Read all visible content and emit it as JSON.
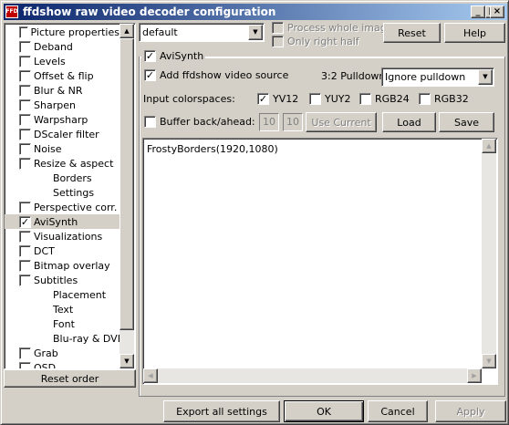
{
  "window": {
    "title": "ffdshow raw video decoder configuration",
    "icon_text": "FFD",
    "minimize": "_",
    "maximize": "□",
    "close": "×"
  },
  "sidebar": {
    "items": [
      {
        "label": "Picture properties",
        "checkbox": true,
        "checked": false
      },
      {
        "label": "Deband",
        "checkbox": true,
        "checked": false
      },
      {
        "label": "Levels",
        "checkbox": true,
        "checked": false
      },
      {
        "label": "Offset & flip",
        "checkbox": true,
        "checked": false
      },
      {
        "label": "Blur & NR",
        "checkbox": true,
        "checked": false
      },
      {
        "label": "Sharpen",
        "checkbox": true,
        "checked": false
      },
      {
        "label": "Warpsharp",
        "checkbox": true,
        "checked": false
      },
      {
        "label": "DScaler filter",
        "checkbox": true,
        "checked": false
      },
      {
        "label": "Noise",
        "checkbox": true,
        "checked": false
      },
      {
        "label": "Resize & aspect",
        "checkbox": true,
        "checked": false
      },
      {
        "label": "Borders",
        "checkbox": false
      },
      {
        "label": "Settings",
        "checkbox": false
      },
      {
        "label": "Perspective corr.",
        "checkbox": true,
        "checked": false
      },
      {
        "label": "AviSynth",
        "checkbox": true,
        "checked": true,
        "selected": true
      },
      {
        "label": "Visualizations",
        "checkbox": true,
        "checked": false
      },
      {
        "label": "DCT",
        "checkbox": true,
        "checked": false
      },
      {
        "label": "Bitmap overlay",
        "checkbox": true,
        "checked": false
      },
      {
        "label": "Subtitles",
        "checkbox": true,
        "checked": false
      },
      {
        "label": "Placement",
        "checkbox": false
      },
      {
        "label": "Text",
        "checkbox": false
      },
      {
        "label": "Font",
        "checkbox": false
      },
      {
        "label": "Blu-ray & DVD",
        "checkbox": false
      },
      {
        "label": "Grab",
        "checkbox": true,
        "checked": false
      },
      {
        "label": "OSD",
        "checkbox": true,
        "checked": false
      }
    ],
    "reset_order": "Reset order"
  },
  "top": {
    "preset_value": "default",
    "process_whole_image": "Process whole image",
    "only_right_half": "Only right half",
    "reset": "Reset",
    "help": "Help"
  },
  "avisynth": {
    "group_title": "AviSynth",
    "group_checked": "✓",
    "add_source_label": "Add ffdshow video source",
    "add_source_checked": "✓",
    "pulldown_label": "3:2 Pulldown",
    "pulldown_value": "Ignore pulldown",
    "colorspaces_label": "Input colorspaces:",
    "colorspaces": [
      {
        "label": "YV12",
        "checked": "✓"
      },
      {
        "label": "YUY2",
        "checked": ""
      },
      {
        "label": "RGB24",
        "checked": ""
      },
      {
        "label": "RGB32",
        "checked": ""
      }
    ],
    "buffer_label": "Buffer back/ahead:",
    "buffer_back": "10",
    "buffer_ahead": "10",
    "use_current": "Use Current",
    "load": "Load",
    "save": "Save",
    "script": "FrostyBorders(1920,1080)"
  },
  "footer": {
    "export": "Export all settings",
    "ok": "OK",
    "cancel": "Cancel",
    "apply": "Apply"
  }
}
